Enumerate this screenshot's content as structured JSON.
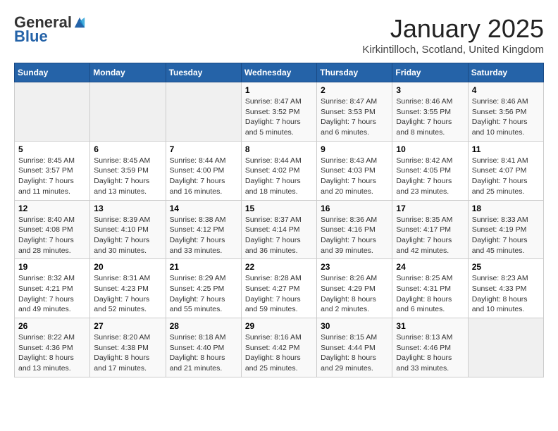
{
  "header": {
    "logo_general": "General",
    "logo_blue": "Blue",
    "month_title": "January 2025",
    "location": "Kirkintilloch, Scotland, United Kingdom"
  },
  "weekdays": [
    "Sunday",
    "Monday",
    "Tuesday",
    "Wednesday",
    "Thursday",
    "Friday",
    "Saturday"
  ],
  "weeks": [
    [
      {
        "day": "",
        "info": ""
      },
      {
        "day": "",
        "info": ""
      },
      {
        "day": "",
        "info": ""
      },
      {
        "day": "1",
        "info": "Sunrise: 8:47 AM\nSunset: 3:52 PM\nDaylight: 7 hours\nand 5 minutes."
      },
      {
        "day": "2",
        "info": "Sunrise: 8:47 AM\nSunset: 3:53 PM\nDaylight: 7 hours\nand 6 minutes."
      },
      {
        "day": "3",
        "info": "Sunrise: 8:46 AM\nSunset: 3:55 PM\nDaylight: 7 hours\nand 8 minutes."
      },
      {
        "day": "4",
        "info": "Sunrise: 8:46 AM\nSunset: 3:56 PM\nDaylight: 7 hours\nand 10 minutes."
      }
    ],
    [
      {
        "day": "5",
        "info": "Sunrise: 8:45 AM\nSunset: 3:57 PM\nDaylight: 7 hours\nand 11 minutes."
      },
      {
        "day": "6",
        "info": "Sunrise: 8:45 AM\nSunset: 3:59 PM\nDaylight: 7 hours\nand 13 minutes."
      },
      {
        "day": "7",
        "info": "Sunrise: 8:44 AM\nSunset: 4:00 PM\nDaylight: 7 hours\nand 16 minutes."
      },
      {
        "day": "8",
        "info": "Sunrise: 8:44 AM\nSunset: 4:02 PM\nDaylight: 7 hours\nand 18 minutes."
      },
      {
        "day": "9",
        "info": "Sunrise: 8:43 AM\nSunset: 4:03 PM\nDaylight: 7 hours\nand 20 minutes."
      },
      {
        "day": "10",
        "info": "Sunrise: 8:42 AM\nSunset: 4:05 PM\nDaylight: 7 hours\nand 23 minutes."
      },
      {
        "day": "11",
        "info": "Sunrise: 8:41 AM\nSunset: 4:07 PM\nDaylight: 7 hours\nand 25 minutes."
      }
    ],
    [
      {
        "day": "12",
        "info": "Sunrise: 8:40 AM\nSunset: 4:08 PM\nDaylight: 7 hours\nand 28 minutes."
      },
      {
        "day": "13",
        "info": "Sunrise: 8:39 AM\nSunset: 4:10 PM\nDaylight: 7 hours\nand 30 minutes."
      },
      {
        "day": "14",
        "info": "Sunrise: 8:38 AM\nSunset: 4:12 PM\nDaylight: 7 hours\nand 33 minutes."
      },
      {
        "day": "15",
        "info": "Sunrise: 8:37 AM\nSunset: 4:14 PM\nDaylight: 7 hours\nand 36 minutes."
      },
      {
        "day": "16",
        "info": "Sunrise: 8:36 AM\nSunset: 4:16 PM\nDaylight: 7 hours\nand 39 minutes."
      },
      {
        "day": "17",
        "info": "Sunrise: 8:35 AM\nSunset: 4:17 PM\nDaylight: 7 hours\nand 42 minutes."
      },
      {
        "day": "18",
        "info": "Sunrise: 8:33 AM\nSunset: 4:19 PM\nDaylight: 7 hours\nand 45 minutes."
      }
    ],
    [
      {
        "day": "19",
        "info": "Sunrise: 8:32 AM\nSunset: 4:21 PM\nDaylight: 7 hours\nand 49 minutes."
      },
      {
        "day": "20",
        "info": "Sunrise: 8:31 AM\nSunset: 4:23 PM\nDaylight: 7 hours\nand 52 minutes."
      },
      {
        "day": "21",
        "info": "Sunrise: 8:29 AM\nSunset: 4:25 PM\nDaylight: 7 hours\nand 55 minutes."
      },
      {
        "day": "22",
        "info": "Sunrise: 8:28 AM\nSunset: 4:27 PM\nDaylight: 7 hours\nand 59 minutes."
      },
      {
        "day": "23",
        "info": "Sunrise: 8:26 AM\nSunset: 4:29 PM\nDaylight: 8 hours\nand 2 minutes."
      },
      {
        "day": "24",
        "info": "Sunrise: 8:25 AM\nSunset: 4:31 PM\nDaylight: 8 hours\nand 6 minutes."
      },
      {
        "day": "25",
        "info": "Sunrise: 8:23 AM\nSunset: 4:33 PM\nDaylight: 8 hours\nand 10 minutes."
      }
    ],
    [
      {
        "day": "26",
        "info": "Sunrise: 8:22 AM\nSunset: 4:36 PM\nDaylight: 8 hours\nand 13 minutes."
      },
      {
        "day": "27",
        "info": "Sunrise: 8:20 AM\nSunset: 4:38 PM\nDaylight: 8 hours\nand 17 minutes."
      },
      {
        "day": "28",
        "info": "Sunrise: 8:18 AM\nSunset: 4:40 PM\nDaylight: 8 hours\nand 21 minutes."
      },
      {
        "day": "29",
        "info": "Sunrise: 8:16 AM\nSunset: 4:42 PM\nDaylight: 8 hours\nand 25 minutes."
      },
      {
        "day": "30",
        "info": "Sunrise: 8:15 AM\nSunset: 4:44 PM\nDaylight: 8 hours\nand 29 minutes."
      },
      {
        "day": "31",
        "info": "Sunrise: 8:13 AM\nSunset: 4:46 PM\nDaylight: 8 hours\nand 33 minutes."
      },
      {
        "day": "",
        "info": ""
      }
    ]
  ]
}
